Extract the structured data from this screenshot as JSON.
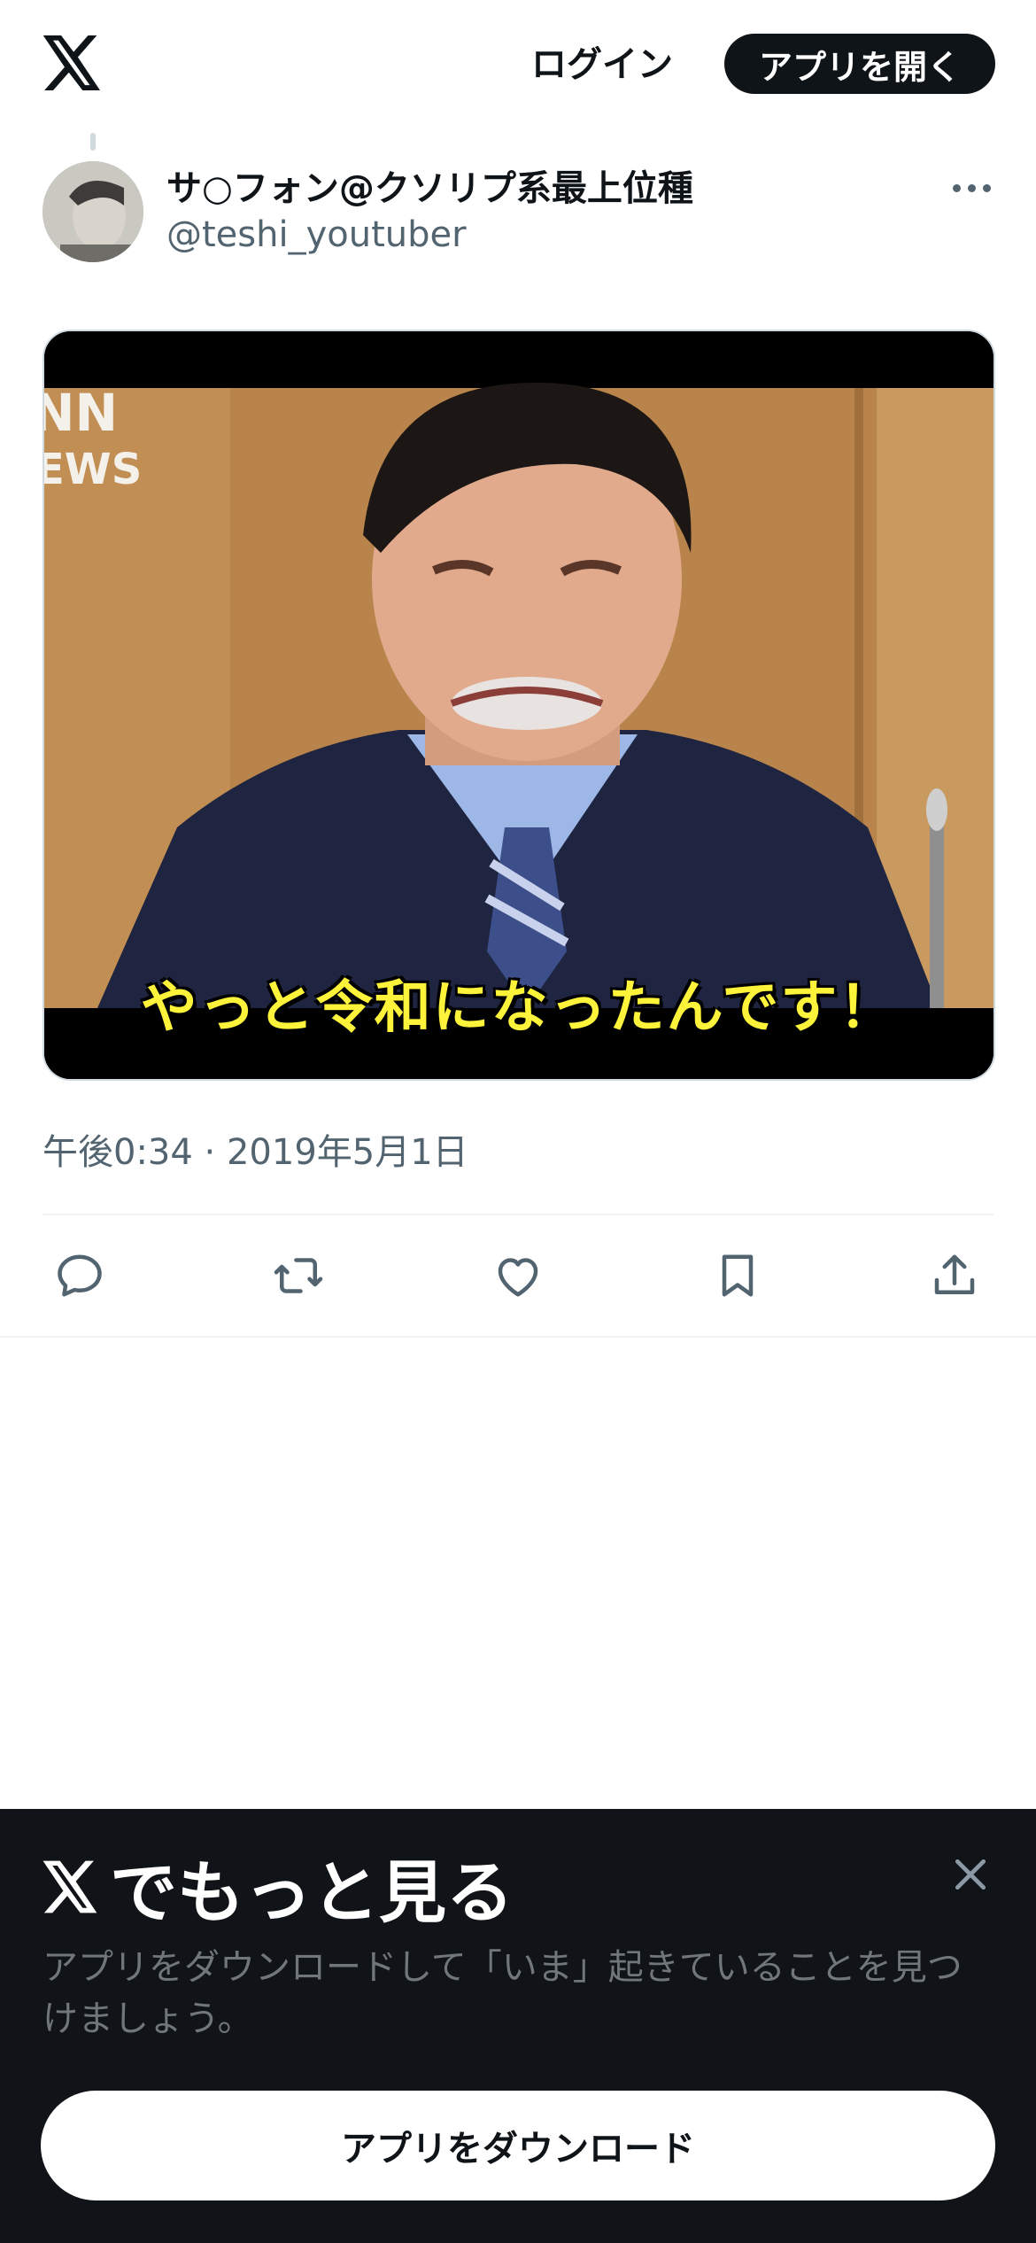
{
  "header": {
    "logo_icon": "x-logo-icon",
    "login_label": "ログイン",
    "open_app_label": "アプリを開く"
  },
  "tweet": {
    "display_name": "サ○フォン@クソリプ系最上位種",
    "handle": "@teshi_youtuber",
    "more_icon": "more-dots-icon",
    "media": {
      "overlay_logo_text": "NN\nEWS",
      "caption": "やっと令和になったんです！"
    },
    "timestamp": "午後0:34 · 2019年5月1日",
    "actions": [
      {
        "icon": "reply-icon"
      },
      {
        "icon": "retweet-icon"
      },
      {
        "icon": "like-icon"
      },
      {
        "icon": "bookmark-icon"
      },
      {
        "icon": "share-icon"
      }
    ]
  },
  "bottom_sheet": {
    "title": "でもっと見る",
    "description": "アプリをダウンロードして「いま」起きていることを見つけましょう。",
    "download_label": "アプリをダウンロード",
    "close_icon": "close-icon"
  },
  "colors": {
    "text_primary": "#0f1419",
    "text_secondary": "#536471",
    "sheet_bg": "#101418",
    "caption_yellow": "#fcf33a"
  }
}
